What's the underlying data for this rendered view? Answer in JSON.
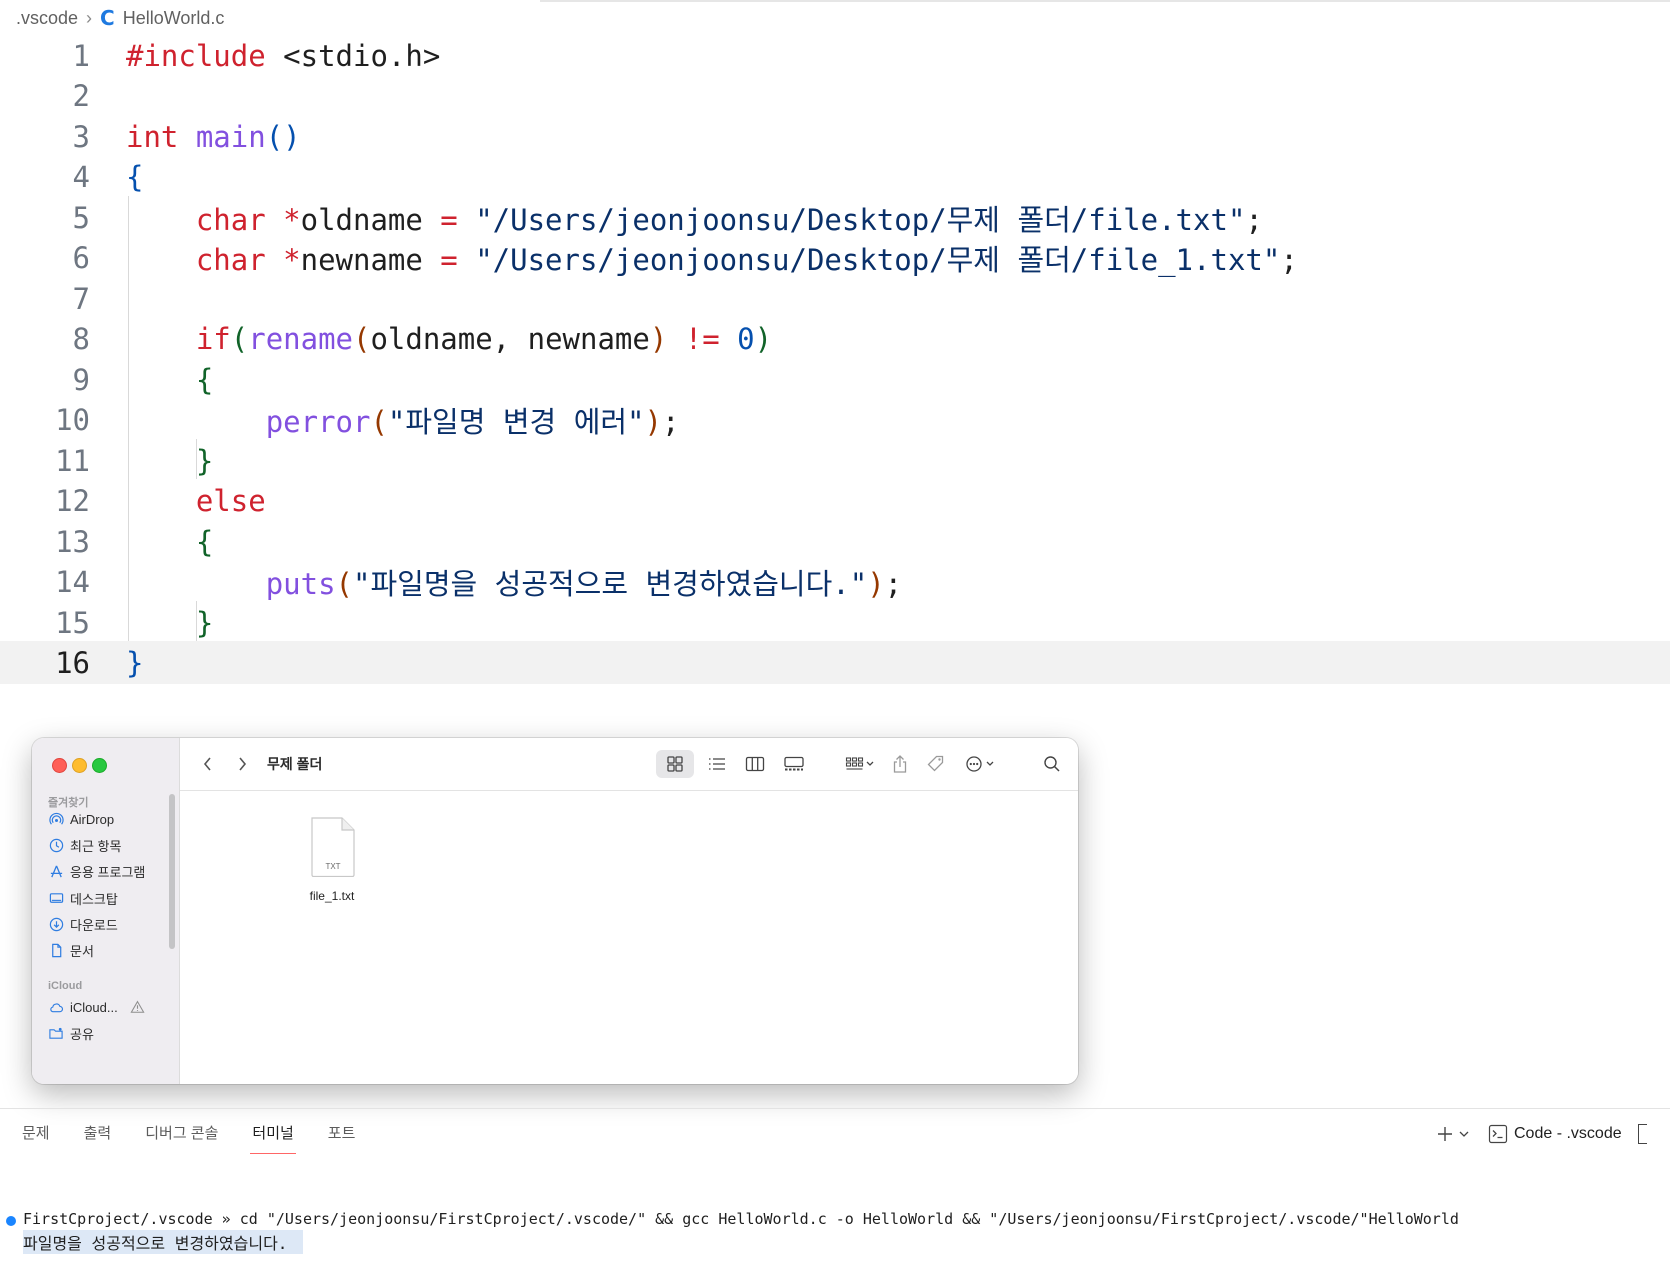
{
  "breadcrumb": {
    "folder": ".vscode",
    "file": "HelloWorld.c"
  },
  "editor": {
    "line_numbers": [
      "1",
      "2",
      "3",
      "4",
      "5",
      "6",
      "7",
      "8",
      "9",
      "10",
      "11",
      "12",
      "13",
      "14",
      "15",
      "16"
    ],
    "active_line": "16",
    "code": {
      "l1_directive": "#include",
      "l1_header": " <stdio.h>",
      "l3_type": "int",
      "l3_func": " main",
      "l3_parens": "()",
      "l4_brace": "{",
      "l5_type": "char",
      "l5_ptr": " *",
      "l5_var": "oldname",
      "l5_eq": " = ",
      "l5_str": "\"/Users/jeonjoonsu/Desktop/무제 폴더/file.txt\"",
      "l5_semi": ";",
      "l6_type": "char",
      "l6_ptr": " *",
      "l6_var": "newname",
      "l6_eq": " = ",
      "l6_str": "\"/Users/jeonjoonsu/Desktop/무제 폴더/file_1.txt\"",
      "l6_semi": ";",
      "l8_if": "if",
      "l8_open": "(",
      "l8_func": "rename",
      "l8_open2": "(",
      "l8_args": "oldname, newname",
      "l8_close2": ")",
      "l8_op": " != ",
      "l8_num": "0",
      "l8_close": ")",
      "l9_brace": "{",
      "l10_func": "perror",
      "l10_open": "(",
      "l10_str": "\"파일명 변경 에러\"",
      "l10_close": ")",
      "l10_semi": ";",
      "l11_brace": "}",
      "l12_else": "else",
      "l13_brace": "{",
      "l14_func": "puts",
      "l14_open": "(",
      "l14_str": "\"파일명을 성공적으로 변경하였습니다.\"",
      "l14_close": ")",
      "l14_semi": ";",
      "l15_brace": "}",
      "l16_brace": "}"
    }
  },
  "finder": {
    "title": "무제 폴더",
    "sidebar": {
      "favorites_header": "즐겨찾기",
      "favorites": [
        "AirDrop",
        "최근 항목",
        "응용 프로그램",
        "데스크탑",
        "다운로드",
        "문서"
      ],
      "icloud_header": "iCloud",
      "icloud": [
        "iCloud...",
        "공유"
      ]
    },
    "file": {
      "name": "file_1.txt",
      "badge": "TXT"
    }
  },
  "panel": {
    "tabs": [
      "문제",
      "출력",
      "디버그 콘솔",
      "터미널",
      "포트"
    ],
    "active_tab": "터미널",
    "terminal_name": "Code - .vscode",
    "add_label": "+"
  },
  "terminal": {
    "command": "FirstCproject/.vscode » cd \"/Users/jeonjoonsu/FirstCproject/.vscode/\" && gcc HelloWorld.c -o HelloWorld && \"/Users/jeonjoonsu/FirstCproject/.vscode/\"HelloWorld",
    "output": "파일명을 성공적으로 변경하였습니다."
  },
  "colors": {
    "keyword": "#cf222e",
    "function": "#8250df",
    "string": "#0a3069",
    "accent": "#1a85ff"
  }
}
